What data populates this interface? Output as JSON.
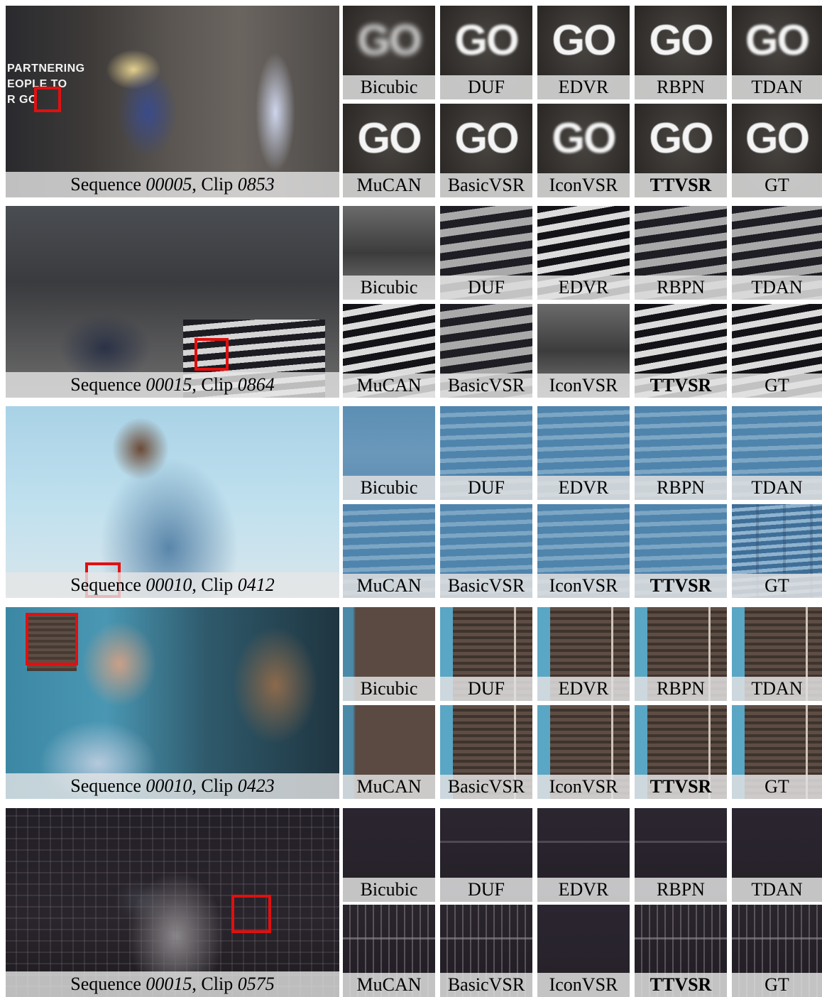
{
  "rows": [
    {
      "caption": {
        "prefix": "Sequence ",
        "sequence": "00005",
        "sep": ", Clip ",
        "clip": "0853"
      },
      "wall_text": "PARTNERING\nEOPLE TO\nR GO",
      "crop_text": "GO",
      "labels": [
        "Bicubic",
        "DUF",
        "EDVR",
        "RBPN",
        "TDAN",
        "MuCAN",
        "BasicVSR",
        "IconVSR",
        "TTVSR",
        "GT"
      ]
    },
    {
      "caption": {
        "prefix": "Sequence ",
        "sequence": "00015",
        "sep": ", Clip ",
        "clip": "0864"
      },
      "labels": [
        "Bicubic",
        "DUF",
        "EDVR",
        "RBPN",
        "TDAN",
        "MuCAN",
        "BasicVSR",
        "IconVSR",
        "TTVSR",
        "GT"
      ]
    },
    {
      "caption": {
        "prefix": "Sequence ",
        "sequence": "00010",
        "sep": ", Clip ",
        "clip": "0412"
      },
      "labels": [
        "Bicubic",
        "DUF",
        "EDVR",
        "RBPN",
        "TDAN",
        "MuCAN",
        "BasicVSR",
        "IconVSR",
        "TTVSR",
        "GT"
      ]
    },
    {
      "caption": {
        "prefix": "Sequence ",
        "sequence": "00010",
        "sep": ", Clip ",
        "clip": "0423"
      },
      "labels": [
        "Bicubic",
        "DUF",
        "EDVR",
        "RBPN",
        "TDAN",
        "MuCAN",
        "BasicVSR",
        "IconVSR",
        "TTVSR",
        "GT"
      ]
    },
    {
      "caption": {
        "prefix": "Sequence ",
        "sequence": "00015",
        "sep": ", Clip ",
        "clip": "0575"
      },
      "labels": [
        "Bicubic",
        "DUF",
        "EDVR",
        "RBPN",
        "TDAN",
        "MuCAN",
        "BasicVSR",
        "IconVSR",
        "TTVSR",
        "GT"
      ]
    }
  ],
  "colors": {
    "highlight_box": "#e01010",
    "caption_bg": "#e6e6e6"
  }
}
